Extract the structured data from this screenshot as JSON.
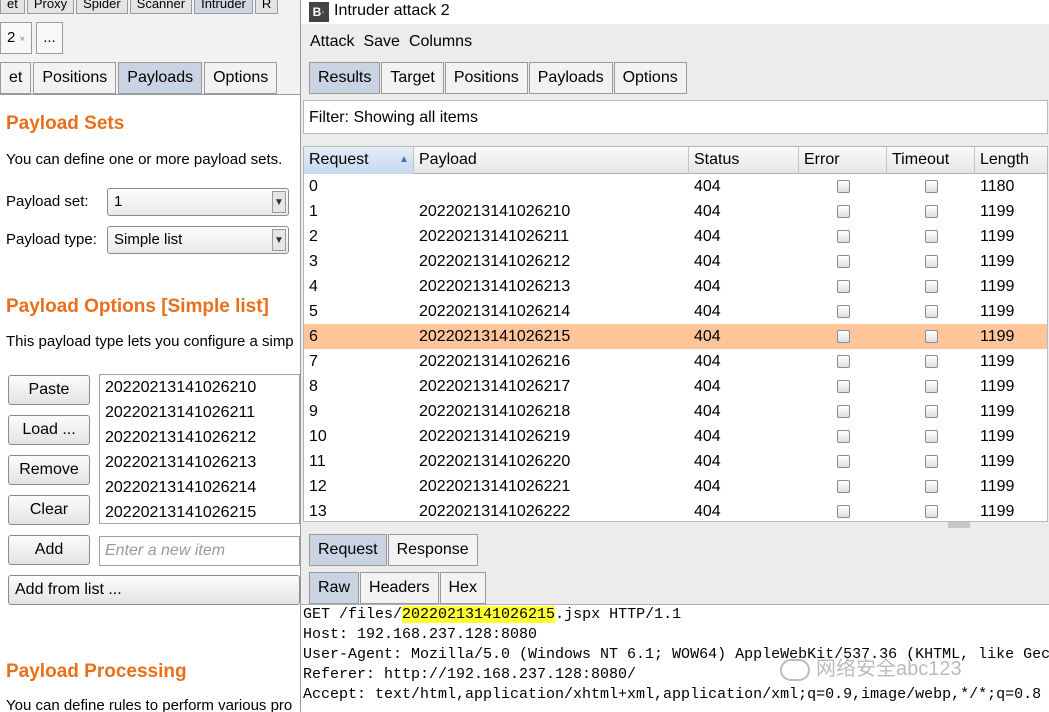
{
  "left_panel": {
    "top_tabs": [
      "et",
      "Proxy",
      "Spider",
      "Scanner",
      "Intruder",
      "R"
    ],
    "number_tabs": [
      {
        "label": "2",
        "close": "×"
      },
      {
        "label": "..."
      }
    ],
    "sub_tabs": [
      "et",
      "Positions",
      "Payloads",
      "Options"
    ],
    "payload_sets_heading": "Payload Sets",
    "payload_sets_desc": "You can define one or more payload sets.",
    "payload_set_label": "Payload set:",
    "payload_set_value": "1",
    "payload_type_label": "Payload type:",
    "payload_type_value": "Simple list",
    "payload_options_heading": "Payload Options [Simple list]",
    "payload_options_desc": "This payload type lets you configure a simp",
    "buttons": {
      "paste": "Paste",
      "load": "Load ...",
      "remove": "Remove",
      "clear": "Clear",
      "add": "Add",
      "add_from_list": "Add from list ..."
    },
    "payload_list": [
      "20220213141026210",
      "20220213141026211",
      "20220213141026212",
      "20220213141026213",
      "20220213141026214",
      "20220213141026215"
    ],
    "new_item_placeholder": "Enter a new item",
    "payload_processing_heading": "Payload Processing",
    "payload_processing_desc": "You can define rules to perform various pro"
  },
  "window": {
    "title": "Intruder attack 2",
    "menu": [
      "Attack",
      "Save",
      "Columns"
    ],
    "tabs": [
      "Results",
      "Target",
      "Positions",
      "Payloads",
      "Options"
    ],
    "filter_text": "Filter: Showing all items",
    "table": {
      "columns": [
        "Request",
        "Payload",
        "Status",
        "Error",
        "Timeout",
        "Length"
      ],
      "rows": [
        {
          "request": "0",
          "payload": "",
          "status": "404",
          "length": "1180"
        },
        {
          "request": "1",
          "payload": "20220213141026210",
          "status": "404",
          "length": "1199"
        },
        {
          "request": "2",
          "payload": "20220213141026211",
          "status": "404",
          "length": "1199"
        },
        {
          "request": "3",
          "payload": "20220213141026212",
          "status": "404",
          "length": "1199"
        },
        {
          "request": "4",
          "payload": "20220213141026213",
          "status": "404",
          "length": "1199"
        },
        {
          "request": "5",
          "payload": "20220213141026214",
          "status": "404",
          "length": "1199"
        },
        {
          "request": "6",
          "payload": "20220213141026215",
          "status": "404",
          "length": "1199"
        },
        {
          "request": "7",
          "payload": "20220213141026216",
          "status": "404",
          "length": "1199"
        },
        {
          "request": "8",
          "payload": "20220213141026217",
          "status": "404",
          "length": "1199"
        },
        {
          "request": "9",
          "payload": "20220213141026218",
          "status": "404",
          "length": "1199"
        },
        {
          "request": "10",
          "payload": "20220213141026219",
          "status": "404",
          "length": "1199"
        },
        {
          "request": "11",
          "payload": "20220213141026220",
          "status": "404",
          "length": "1199"
        },
        {
          "request": "12",
          "payload": "20220213141026221",
          "status": "404",
          "length": "1199"
        },
        {
          "request": "13",
          "payload": "20220213141026222",
          "status": "404",
          "length": "1199"
        }
      ],
      "selected_row": 6
    },
    "reqresp_tabs": [
      "Request",
      "Response"
    ],
    "raw_tabs": [
      "Raw",
      "Headers",
      "Hex"
    ],
    "raw": {
      "line1_prefix": "GET /files/",
      "line1_highlight": "20220213141026215",
      "line1_suffix": ".jspx HTTP/1.1",
      "lines": [
        "Host: 192.168.237.128:8080",
        "User-Agent: Mozilla/5.0 (Windows NT 6.1; WOW64) AppleWebKit/537.36 (KHTML, like Gec",
        "Referer: http://192.168.237.128:8080/",
        "Accept: text/html,application/xhtml+xml,application/xml;q=0.9,image/webp,*/*;q=0.8"
      ]
    }
  },
  "watermark": "网络安全abc123",
  "colors": {
    "accent_orange": "#e8701a",
    "selected_row": "#ffc49a",
    "highlight": "#ffff33"
  }
}
